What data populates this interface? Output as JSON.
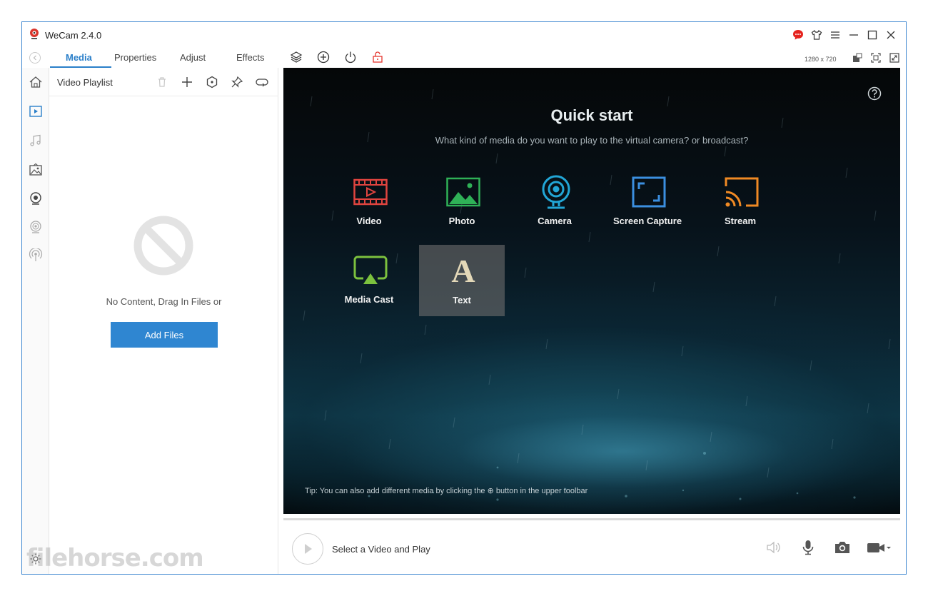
{
  "window": {
    "title": "WeCam 2.4.0"
  },
  "tabs": [
    {
      "label": "Media",
      "active": true
    },
    {
      "label": "Properties",
      "active": false
    },
    {
      "label": "Adjust",
      "active": false
    },
    {
      "label": "Effects",
      "active": false
    }
  ],
  "toolbar": {
    "icons": [
      "layers-icon",
      "add-circle-icon",
      "power-icon",
      "unlock-icon"
    ],
    "resolution": "1280 x 720",
    "right_icons": [
      "pip-icon",
      "fit-screen-icon",
      "fullscreen-icon"
    ]
  },
  "title_controls": [
    "feedback-icon",
    "skin-icon",
    "menu-icon",
    "minimize-icon",
    "maximize-icon",
    "close-icon"
  ],
  "rail": {
    "items": [
      "home-icon",
      "video-media-icon",
      "music-icon",
      "image-icon",
      "webcam-icon",
      "webcam-alt-icon",
      "broadcast-icon"
    ],
    "footer": "settings-icon"
  },
  "playlist": {
    "title": "Video Playlist",
    "tools": [
      "trash-icon",
      "add-icon",
      "target-icon",
      "pin-icon",
      "loop-icon"
    ],
    "empty_text": "No Content, Drag In Files or",
    "add_button": "Add Files"
  },
  "quick_start": {
    "title": "Quick start",
    "subtitle": "What kind of media do you want to play to the virtual camera? or broadcast?",
    "items": [
      {
        "label": "Video",
        "icon": "film-icon",
        "color": "#e0443f"
      },
      {
        "label": "Photo",
        "icon": "photo-icon",
        "color": "#2fb157"
      },
      {
        "label": "Camera",
        "icon": "webcam-icon",
        "color": "#22a6d6"
      },
      {
        "label": "Screen Capture",
        "icon": "screen-capture-icon",
        "color": "#3b8fe0"
      },
      {
        "label": "Stream",
        "icon": "cast-icon",
        "color": "#f08a24"
      },
      {
        "label": "Media Cast",
        "icon": "airplay-icon",
        "color": "#7cc13e"
      },
      {
        "label": "Text",
        "icon": "text-icon",
        "color": "#e3d8b8",
        "hovered": true
      }
    ],
    "tip": "Tip: You can also add different media by clicking the ⊕ button in the upper toolbar"
  },
  "player": {
    "label": "Select a Video and Play",
    "icons": [
      "volume-icon",
      "microphone-icon",
      "snapshot-icon",
      "video-camera-icon"
    ]
  },
  "watermark": "filehorse.com"
}
